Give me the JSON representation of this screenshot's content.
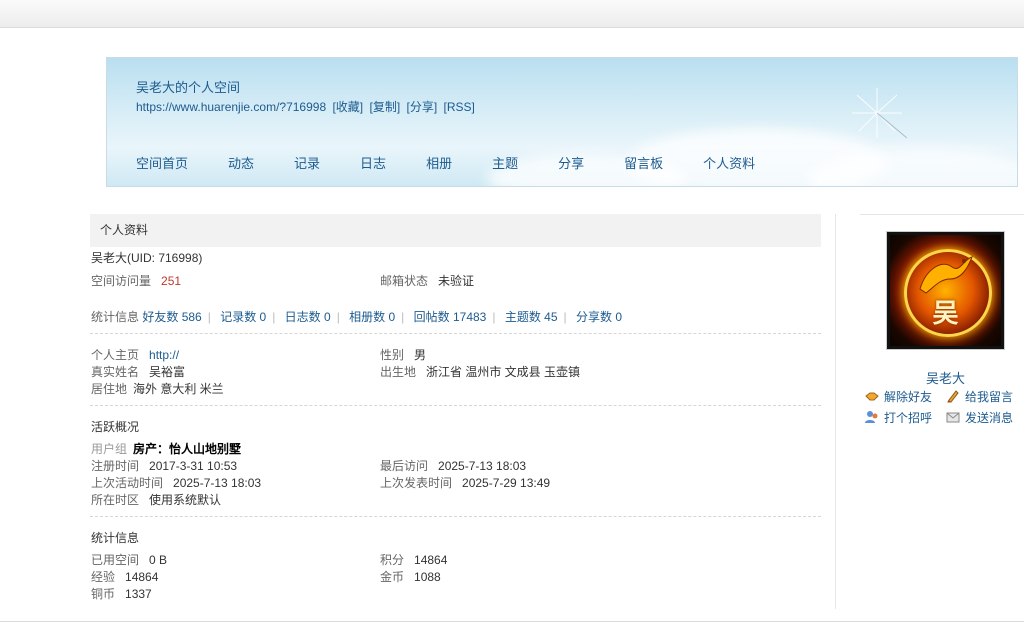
{
  "header": {
    "space_title": "吴老大的个人空间",
    "url": "https://www.huarenjie.com/?716998",
    "url_links": [
      "[收藏]",
      "[复制]",
      "[分享]",
      "[RSS]"
    ],
    "nav": [
      "空间首页",
      "动态",
      "记录",
      "日志",
      "相册",
      "主题",
      "分享",
      "留言板",
      "个人资料"
    ]
  },
  "profile": {
    "section_title": "个人资料",
    "name_uid": "吴老大(UID: 716998)",
    "visits_label": "空间访问量",
    "visits_value": "251",
    "email_label": "邮箱状态",
    "email_value": "未验证",
    "stats_label": "统计信息",
    "stats": [
      "好友数 586",
      "记录数 0",
      "日志数 0",
      "相册数 0",
      "回帖数 17483",
      "主题数 45",
      "分享数 0"
    ],
    "homepage_label": "个人主页",
    "homepage_value": "http://",
    "gender_label": "性别",
    "gender_value": "男",
    "realname_label": "真实姓名",
    "realname_value": "吴裕富",
    "birthplace_label": "出生地",
    "birthplace_value": "浙江省 温州市 文成县 玉壶镇",
    "residence_label": "居住地",
    "residence_value": "海外 意大利 米兰"
  },
  "activity": {
    "title": "活跃概况",
    "usergroup_label": "用户组",
    "usergroup_value": "房产：怡人山地别墅",
    "reg_label": "注册时间",
    "reg_value": "2017-3-31 10:53",
    "lastvisit_label": "最后访问",
    "lastvisit_value": "2025-7-13 18:03",
    "lastactive_label": "上次活动时间",
    "lastactive_value": "2025-7-13 18:03",
    "lastpost_label": "上次发表时间",
    "lastpost_value": "2025-7-29 13:49",
    "timezone_label": "所在时区",
    "timezone_value": "使用系统默认"
  },
  "statistics": {
    "title": "统计信息",
    "space_label": "已用空间",
    "space_value": "0 B",
    "points_label": "积分",
    "points_value": "14864",
    "exp_label": "经验",
    "exp_value": "14864",
    "gold_label": "金币",
    "gold_value": "1088",
    "copper_label": "铜币",
    "copper_value": "1337"
  },
  "sidebar": {
    "username": "吴老大",
    "avatar_text": "吴",
    "actions": [
      {
        "label": "解除好友",
        "icon": "handshake-icon"
      },
      {
        "label": "给我留言",
        "icon": "pencil-icon"
      },
      {
        "label": "打个招呼",
        "icon": "users-icon"
      },
      {
        "label": "发送消息",
        "icon": "envelope-icon"
      }
    ]
  },
  "colors": {
    "link": "#1d5b8f",
    "accent_red": "#c0392b",
    "banner_sky": "#b9dff0"
  }
}
